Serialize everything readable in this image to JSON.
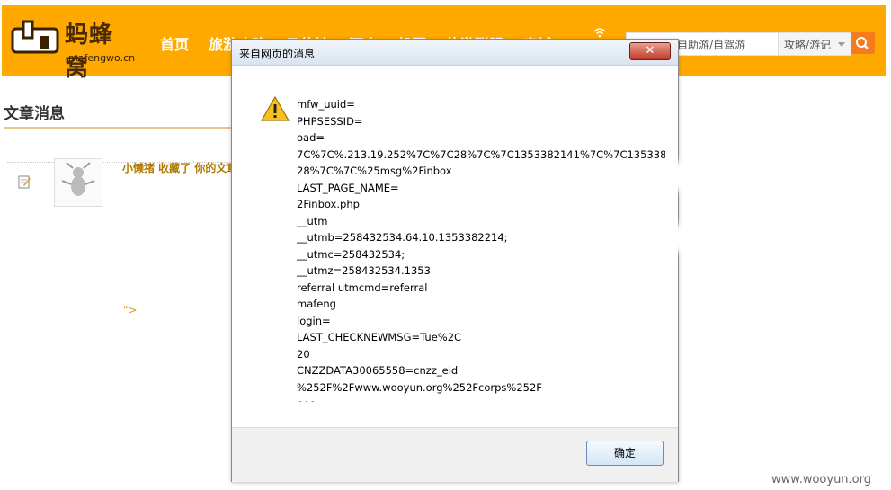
{
  "header": {
    "logo_cn": "蚂蜂窝",
    "logo_en": "mafengwo.cn",
    "nav": [
      "首页",
      "旅游攻略",
      "目的地",
      "酒店",
      "机票",
      "旅游联盟",
      "商城"
    ],
    "search_placeholder": "自助游/自驾游",
    "search_category": "攻略/游记"
  },
  "page": {
    "title": "文章消息",
    "notice_text": "小懒猪 收藏了 你的文章",
    "stray_text": "\">"
  },
  "dialog": {
    "title": "来自网页的消息",
    "close_label": "✕",
    "ok_label": "确定",
    "message_lines": [
      "mfw_uuid=",
      "PHPSESSID=",
      "oad=",
      "7C%7C%.213.19.252%7C%7C28%7C%7C1353382141%7C%7C135338",
      "28%7C%7C%25msg%2Finbox",
      "LAST_PAGE_NAME=",
      "2Finbox.php",
      "__utm",
      "__utmb=258432534.64.10.1353382214;",
      "__utmc=258432534;",
      "__utmz=258432534.1353",
      "referral utmcmd=referral",
      "mafeng",
      "login=",
      "LAST_CHECKNEWMSG=Tue%2C",
      "20",
      "CNZZDATA30065558=cnzz_eid",
      "%252F%2Fwww.wooyun.org%252Fcorps%252F",
      "neo"
    ]
  },
  "watermark": "www.wooyun.org"
}
